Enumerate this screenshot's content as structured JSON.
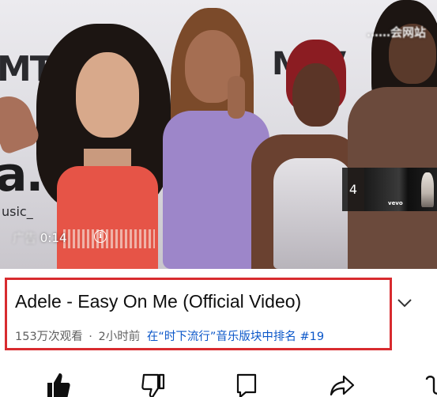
{
  "player": {
    "watermark": "……会网站",
    "countdown_prefix": "广告",
    "countdown_time": "0:14",
    "backdrop_logo": "MTV",
    "backdrop_text": "a.",
    "backdrop_subtext": "usic_",
    "next_card": {
      "count": "4",
      "brand": "vevo"
    }
  },
  "video": {
    "title": "Adele - Easy On Me (Official Video)",
    "views": "153万次观看",
    "separator": "·",
    "age": "2小时前",
    "trending": "在“时下流行”音乐版块中排名 #19"
  },
  "colors": {
    "highlight_border": "#d82b2f",
    "link_blue": "#0b57c9",
    "meta_gray": "#606060",
    "title_black": "#0f0f0f"
  },
  "actions": [
    {
      "name": "like-icon"
    },
    {
      "name": "dislike-icon"
    },
    {
      "name": "comment-icon"
    },
    {
      "name": "share-icon"
    },
    {
      "name": "remix-icon"
    }
  ]
}
